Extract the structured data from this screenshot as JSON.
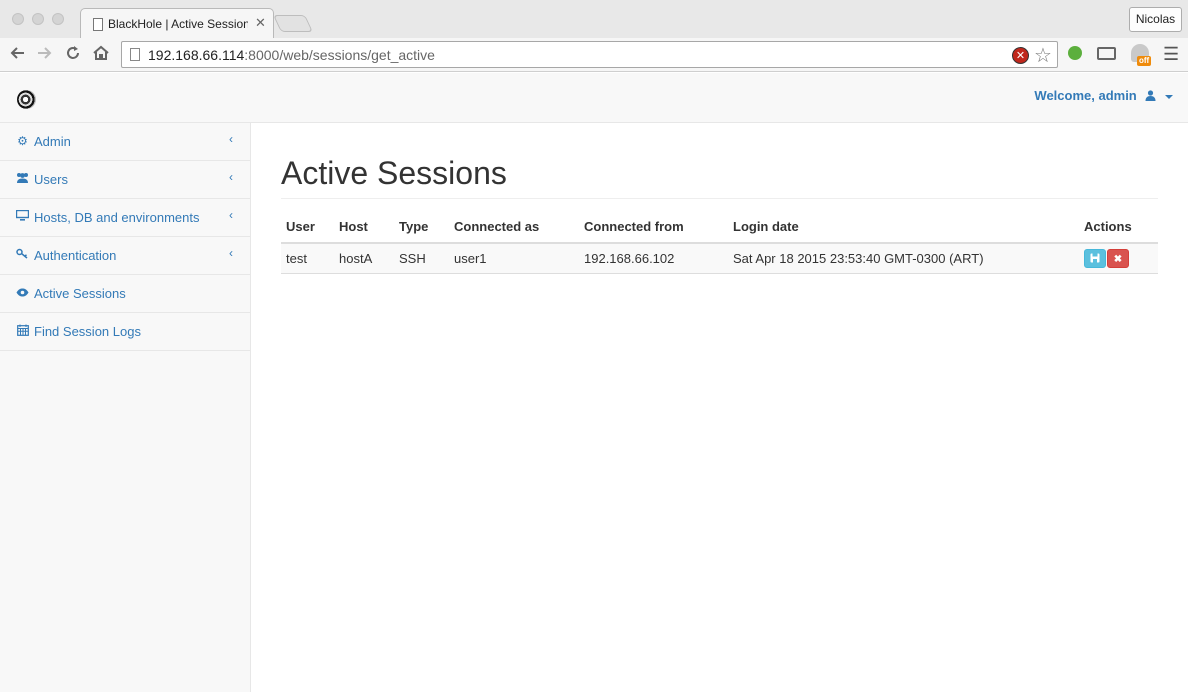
{
  "browser": {
    "tab_title": "BlackHole | Active Sessions",
    "tab_close_glyph": "✕",
    "profile_name": "Nicolas",
    "url_host": "192.168.66.114",
    "url_path": ":8000/web/sessions/get_active",
    "extension_badge": "off",
    "icons": [
      "back-icon",
      "forward-icon",
      "reload-icon",
      "home-icon",
      "page-icon",
      "blocked-icon",
      "bookmark-star-icon",
      "evernote-icon",
      "cast-icon",
      "ghostery-icon",
      "menu-icon"
    ]
  },
  "header": {
    "logo": "blackhole-logo",
    "welcome_text": "Welcome, admin",
    "user_icon": "user-icon"
  },
  "sidebar": {
    "items": [
      {
        "label": "Admin",
        "icon": "cogs-icon",
        "has_submenu": true
      },
      {
        "label": "Users",
        "icon": "users-icon",
        "has_submenu": true
      },
      {
        "label": "Hosts, DB and environments",
        "icon": "desktop-icon",
        "has_submenu": true
      },
      {
        "label": "Authentication",
        "icon": "key-icon",
        "has_submenu": true
      },
      {
        "label": "Active Sessions",
        "icon": "eye-icon",
        "has_submenu": false
      },
      {
        "label": "Find Session Logs",
        "icon": "calendar-icon",
        "has_submenu": false
      }
    ]
  },
  "main": {
    "title": "Active Sessions",
    "table": {
      "columns": [
        "User",
        "Host",
        "Type",
        "Connected as",
        "Connected from",
        "Login date",
        "Actions"
      ],
      "rows": [
        {
          "user": "test",
          "host": "hostA",
          "type": "SSH",
          "connected_as": "user1",
          "connected_from": "192.168.66.102",
          "login_date": "Sat Apr 18 2015 23:53:40 GMT-0300 (ART)",
          "actions": [
            "save-icon",
            "close-icon"
          ]
        }
      ]
    }
  },
  "colors": {
    "link": "#337ab7",
    "info_button": "#5bc0de",
    "danger_button": "#d9534f"
  }
}
